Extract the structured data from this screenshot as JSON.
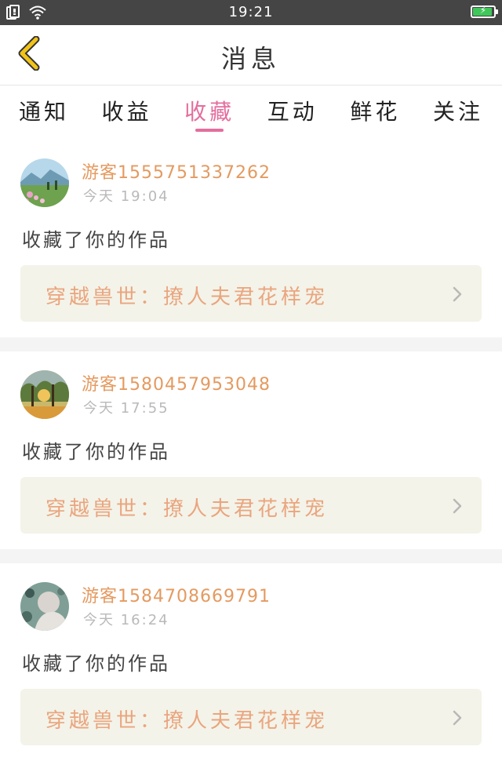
{
  "status_bar": {
    "time": "19:21"
  },
  "header": {
    "title": "消息"
  },
  "tabs": [
    {
      "label": "通知",
      "active": false
    },
    {
      "label": "收益",
      "active": false
    },
    {
      "label": "收藏",
      "active": true
    },
    {
      "label": "互动",
      "active": false
    },
    {
      "label": "鲜花",
      "active": false
    },
    {
      "label": "关注",
      "active": false
    }
  ],
  "messages": [
    {
      "username": "游客15557513372​62",
      "time": "今天 19:04",
      "action": "收藏了你的作品",
      "work_title": "穿越兽世：撩人夫君花样宠"
    },
    {
      "username": "游客1580457953048",
      "time": "今天 17:55",
      "action": "收藏了你的作品",
      "work_title": "穿越兽世：撩人夫君花样宠"
    },
    {
      "username": "游客1584708669791",
      "time": "今天 16:24",
      "action": "收藏了你的作品",
      "work_title": "穿越兽世：撩人夫君花样宠"
    }
  ],
  "colors": {
    "accent": "#e46e9e",
    "username": "#e49a60",
    "work_title": "#eaa57e",
    "card_bg": "#f3f3e9",
    "status_bar": "#454545",
    "back_arrow": "#f2c318"
  }
}
